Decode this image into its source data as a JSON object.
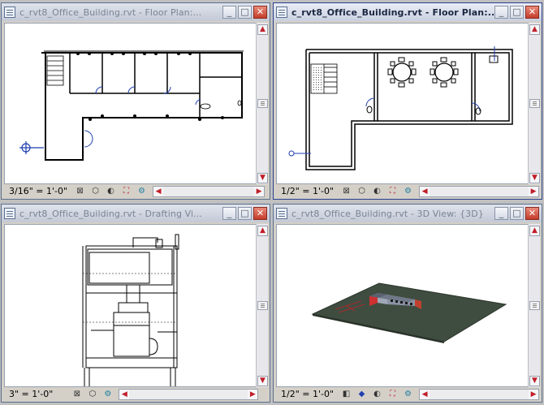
{
  "windows": [
    {
      "title": "c_rvt8_Office_Building.rvt - Floor Plan:...",
      "scale": "3/16\" = 1'-0\"",
      "active": false
    },
    {
      "title": "c_rvt8_Office_Building.rvt - Floor Plan:...",
      "scale": "1/2\" = 1'-0\"",
      "active": true
    },
    {
      "title": "c_rvt8_Office_Building.rvt - Drafting Vi...",
      "scale": "3\" = 1'-0\"",
      "active": false
    },
    {
      "title": "c_rvt8_Office_Building.rvt - 3D View: {3D}",
      "scale": "1/2\" = 1'-0\"",
      "active": false
    }
  ],
  "controls": {
    "minimize": "_",
    "restore": "□",
    "close": "✕",
    "scroll_up": "▲",
    "scroll_down": "▼",
    "scroll_left": "◀",
    "scroll_right": "▶"
  },
  "colors": {
    "accent_red": "#c0202a",
    "plan_blue": "#1f3fb0",
    "site_green": "#3a4a3a"
  }
}
